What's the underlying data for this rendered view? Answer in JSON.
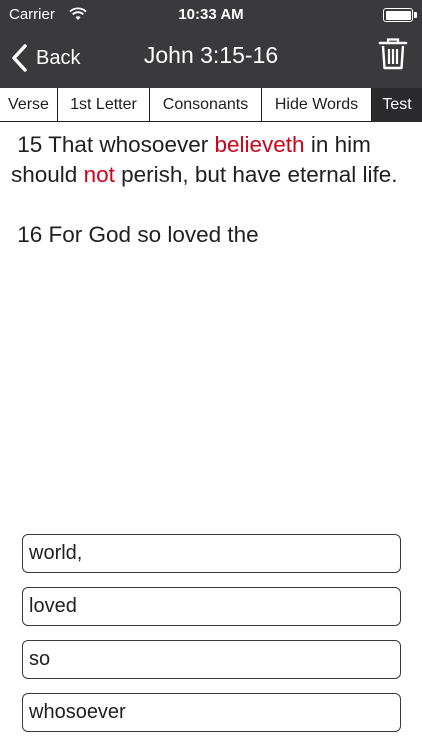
{
  "status": {
    "carrier": "Carrier",
    "time": "10:33 AM"
  },
  "nav": {
    "back_label": "Back",
    "title": "John 3:15-16"
  },
  "segments": [
    {
      "label": "Verse",
      "active": false
    },
    {
      "label": "1st Letter",
      "active": false
    },
    {
      "label": "Consonants",
      "active": false
    },
    {
      "label": "Hide Words",
      "active": false
    },
    {
      "label": "Test",
      "active": true
    }
  ],
  "verse15": {
    "part1": "15 That whosoever ",
    "hl1": "believeth",
    "part2": " in him should ",
    "hl2": "not",
    "part3": " perish, but have eternal life."
  },
  "verse16": {
    "text": "16 For God so loved the"
  },
  "answers": [
    "world,",
    "loved",
    "so",
    "whosoever"
  ],
  "colors": {
    "header": "#3a3a3c",
    "highlight": "#d0021b",
    "active_segment": "#2b2b2d"
  }
}
